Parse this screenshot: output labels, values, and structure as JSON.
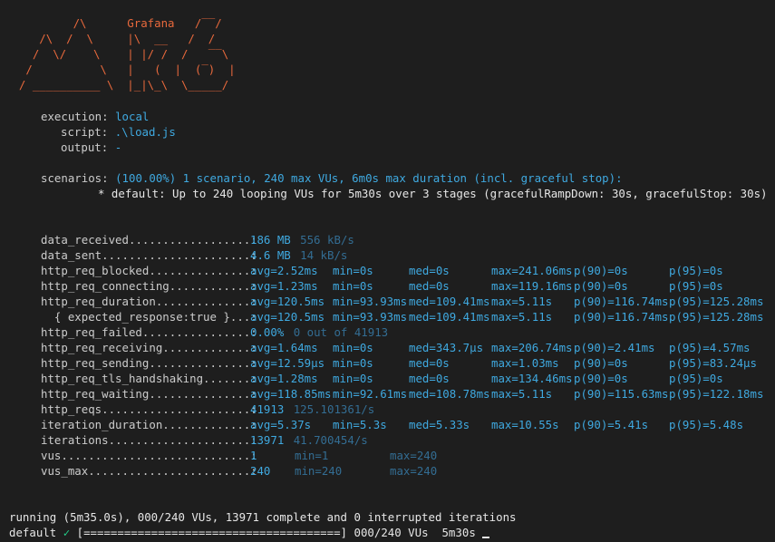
{
  "logo": {
    "lines": [
      "          /\\      Grafana   /‾‾/",
      "     /\\  /  \\     |\\  __   /  /",
      "    /  \\/    \\    | |/ /  /   ‾‾\\",
      "   /          \\   |   (  |  (‾)  |",
      "  / __________ \\  |_|\\_\\  \\_____/"
    ]
  },
  "execution": {
    "execution_label": "execution:",
    "execution_value": "local",
    "script_label": "script:",
    "script_value": ".\\load.js",
    "output_label": "output:",
    "output_value": "-"
  },
  "scenarios": {
    "label": "scenarios:",
    "summary": "(100.00%) 1 scenario, 240 max VUs, 6m0s max duration (incl. graceful stop):",
    "detail": "* default: Up to 240 looping VUs for 5m30s over 3 stages (gracefulRampDown: 30s, gracefulStop: 30s)"
  },
  "metrics": [
    {
      "name": "data_received",
      "dots": "..................:",
      "type": "rate",
      "value": "186 MB",
      "rate": "556 kB/s"
    },
    {
      "name": "data_sent",
      "dots": "......................:",
      "type": "rate",
      "value": "4.6 MB",
      "rate": "14 kB/s"
    },
    {
      "name": "http_req_blocked",
      "dots": "...............:",
      "type": "trend",
      "avg": "avg=2.52ms",
      "min": "min=0s",
      "med": "med=0s",
      "max": "max=241.06ms",
      "p90": "p(90)=0s",
      "p95": "p(95)=0s"
    },
    {
      "name": "http_req_connecting",
      "dots": "............:",
      "type": "trend",
      "avg": "avg=1.23ms",
      "min": "min=0s",
      "med": "med=0s",
      "max": "max=119.16ms",
      "p90": "p(90)=0s",
      "p95": "p(95)=0s"
    },
    {
      "name": "http_req_duration",
      "dots": "..............:",
      "type": "trend",
      "avg": "avg=120.5ms",
      "min": "min=93.93ms",
      "med": "med=109.41ms",
      "max": "max=5.11s",
      "p90": "p(90)=116.74ms",
      "p95": "p(95)=125.28ms"
    },
    {
      "name": "  { expected_response:true }",
      "dots": "...:",
      "type": "trend",
      "avg": "avg=120.5ms",
      "min": "min=93.93ms",
      "med": "med=109.41ms",
      "max": "max=5.11s",
      "p90": "p(90)=116.74ms",
      "p95": "p(95)=125.28ms"
    },
    {
      "name": "http_req_failed",
      "dots": "................:",
      "type": "rate",
      "value": "0.00%",
      "rate": "0 out of 41913"
    },
    {
      "name": "http_req_receiving",
      "dots": ".............:",
      "type": "trend",
      "avg": "avg=1.64ms",
      "min": "min=0s",
      "med": "med=343.7µs",
      "max": "max=206.74ms",
      "p90": "p(90)=2.41ms",
      "p95": "p(95)=4.57ms"
    },
    {
      "name": "http_req_sending",
      "dots": "...............:",
      "type": "trend",
      "avg": "avg=12.59µs",
      "min": "min=0s",
      "med": "med=0s",
      "max": "max=1.03ms",
      "p90": "p(90)=0s",
      "p95": "p(95)=83.24µs"
    },
    {
      "name": "http_req_tls_handshaking",
      "dots": ".......:",
      "type": "trend",
      "avg": "avg=1.28ms",
      "min": "min=0s",
      "med": "med=0s",
      "max": "max=134.46ms",
      "p90": "p(90)=0s",
      "p95": "p(95)=0s"
    },
    {
      "name": "http_req_waiting",
      "dots": "...............:",
      "type": "trend",
      "avg": "avg=118.85ms",
      "min": "min=92.61ms",
      "med": "med=108.78ms",
      "max": "max=5.11s",
      "p90": "p(90)=115.63ms",
      "p95": "p(95)=122.18ms"
    },
    {
      "name": "http_reqs",
      "dots": "......................:",
      "type": "rate",
      "value": "41913",
      "rate": "125.101361/s"
    },
    {
      "name": "iteration_duration",
      "dots": ".............:",
      "type": "trend",
      "avg": "avg=5.37s",
      "min": "min=5.3s",
      "med": "med=5.33s",
      "max": "max=10.55s",
      "p90": "p(90)=5.41s",
      "p95": "p(95)=5.48s"
    },
    {
      "name": "iterations",
      "dots": ".....................:",
      "type": "rate",
      "value": "13971",
      "rate": "41.700454/s"
    },
    {
      "name": "vus",
      "dots": "............................:",
      "type": "gauge",
      "value": "1",
      "min": "min=1",
      "max": "max=240"
    },
    {
      "name": "vus_max",
      "dots": "........................:",
      "type": "gauge",
      "value": "240",
      "min": "min=240",
      "max": "max=240"
    }
  ],
  "footer": {
    "running": "running (5m35.0s), 000/240 VUs, 13971 complete and 0 interrupted iterations",
    "scenario": "default",
    "check": "✓",
    "progress_bar": "[======================================]",
    "progress_status": "000/240 VUs  5m30s"
  },
  "colors": {
    "background": "#1e1e1e",
    "text": "#cccccc",
    "logo": "#e8693c",
    "value": "#3fa9e0",
    "secondary": "#336d93",
    "check": "#23d18b"
  }
}
